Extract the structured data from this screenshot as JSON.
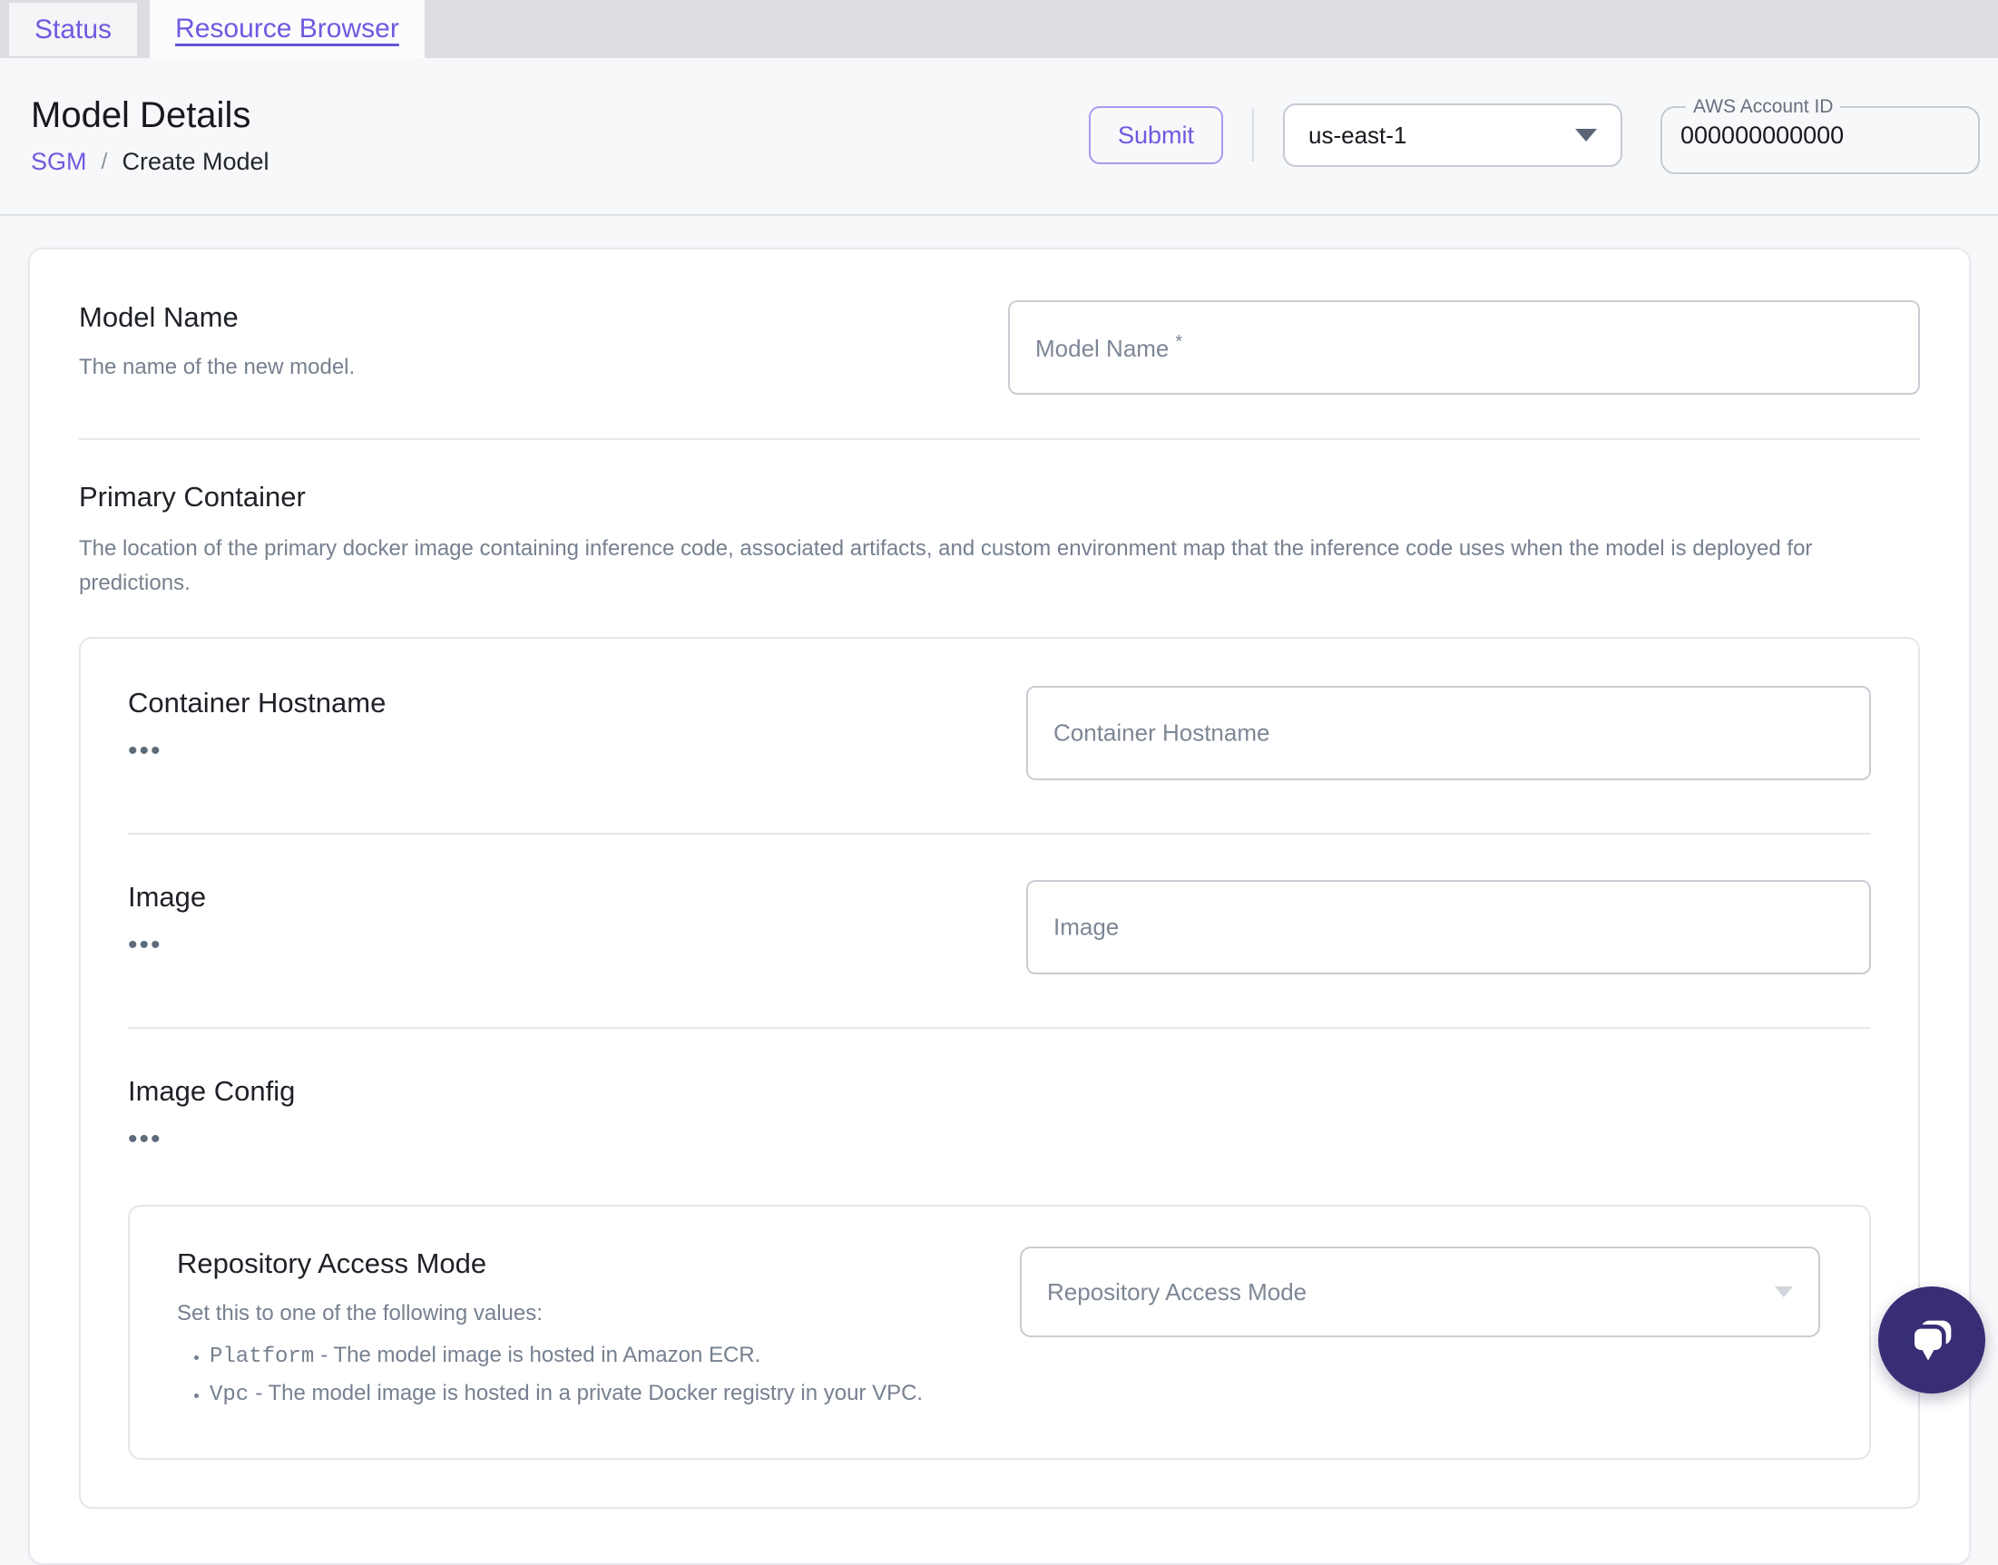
{
  "accent_color": "#6e5ae0",
  "chat_fab_color": "#372e75",
  "tabs": {
    "status": "Status",
    "resource_browser": "Resource Browser"
  },
  "header": {
    "title": "Model Details",
    "breadcrumb": {
      "root": "SGM",
      "separator": "/",
      "current": "Create Model"
    },
    "submit_label": "Submit",
    "region_select": {
      "value": "us-east-1"
    },
    "account_field": {
      "label": "AWS Account ID",
      "value": "000000000000"
    }
  },
  "ui": {
    "ellipsis": "•••"
  },
  "form": {
    "model_name": {
      "label": "Model Name",
      "description": "The name of the new model.",
      "placeholder": "Model Name",
      "required_marker": "*"
    },
    "primary_container": {
      "label": "Primary Container",
      "description": "The location of the primary docker image containing inference code, associated artifacts, and custom environment map that the inference code uses when the model is deployed for predictions.",
      "container_hostname": {
        "label": "Container Hostname",
        "placeholder": "Container Hostname"
      },
      "image": {
        "label": "Image",
        "placeholder": "Image"
      },
      "image_config": {
        "label": "Image Config",
        "repository_access_mode": {
          "label": "Repository Access Mode",
          "description": "Set this to one of the following values:",
          "bullets": [
            {
              "code": "Platform",
              "text": "- The model image is hosted in Amazon ECR."
            },
            {
              "code": "Vpc",
              "text": "- The model image is hosted in a private Docker registry in your VPC."
            }
          ],
          "placeholder": "Repository Access Mode"
        }
      }
    }
  }
}
